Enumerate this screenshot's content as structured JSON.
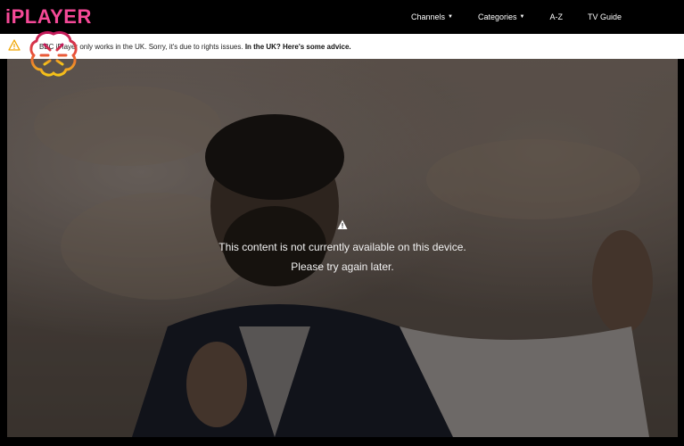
{
  "header": {
    "logo": "iPLAYER",
    "nav": [
      {
        "label": "Channels",
        "has_caret": true
      },
      {
        "label": "Categories",
        "has_caret": true
      },
      {
        "label": "A-Z",
        "has_caret": false
      },
      {
        "label": "TV Guide",
        "has_caret": false
      }
    ]
  },
  "notice": {
    "text": "BBC iPlayer only works in the UK. Sorry, it's due to rights issues.",
    "link": "In the UK? Here's some advice.",
    "icon": "warning-triangle-icon",
    "icon_color": "#f0a500"
  },
  "overlay_badge": {
    "icon": "brain-icon"
  },
  "player": {
    "message_icon": "warning-triangle-icon",
    "message": "This content is not currently available on this device.",
    "submessage": "Please try again later."
  },
  "colors": {
    "brand": "#f54997",
    "topbar": "#000000",
    "notice_bg": "#ffffff"
  }
}
